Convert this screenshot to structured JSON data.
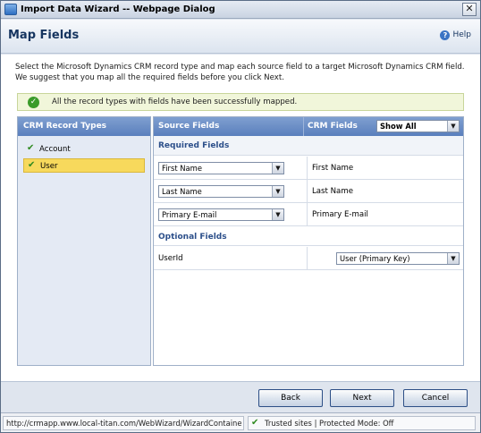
{
  "window": {
    "title": "Import Data Wizard -- Webpage Dialog",
    "close_glyph": "✕"
  },
  "header": {
    "title": "Map Fields",
    "help_label": "Help"
  },
  "instructions": "Select the Microsoft Dynamics CRM record type and map each source field to a target Microsoft Dynamics CRM field. We suggest that you map all the required fields before you click Next.",
  "success_message": "All the record types with fields have been successfully mapped.",
  "record_types": {
    "header": "CRM Record Types",
    "items": [
      {
        "label": "Account",
        "selected": false
      },
      {
        "label": "User",
        "selected": true
      }
    ]
  },
  "mapping": {
    "source_header": "Source Fields",
    "crm_header": "CRM Fields",
    "filter_value": "Show All",
    "required_label": "Required Fields",
    "required_rows": [
      {
        "source": "First Name",
        "crm": "First Name"
      },
      {
        "source": "Last Name",
        "crm": "Last Name"
      },
      {
        "source": "Primary E-mail",
        "crm": "Primary E-mail"
      }
    ],
    "optional_label": "Optional Fields",
    "optional_rows": [
      {
        "source": "UserId",
        "crm": "User (Primary Key)"
      }
    ]
  },
  "footer": {
    "back": "Back",
    "next": "Next",
    "cancel": "Cancel"
  },
  "status": {
    "url": "http://crmapp.www.local-titan.com/WebWizard/WizardContaine",
    "zone": "Trusted sites | Protected Mode: Off"
  },
  "icons": [
    "app-icon",
    "close-icon",
    "help-icon",
    "check-icon",
    "tick-icon",
    "dropdown-arrow-icon"
  ]
}
